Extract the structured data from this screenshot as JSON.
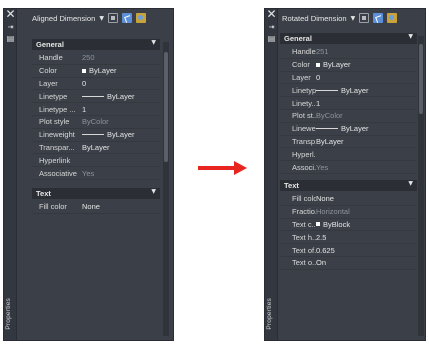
{
  "left": {
    "title": "Aligned Dimension",
    "strip_label": "Properties",
    "sections": {
      "general": {
        "title": "General",
        "rows": [
          {
            "label": "Handle",
            "value": "250",
            "readonly": true
          },
          {
            "label": "Color",
            "value": "ByLayer",
            "swatch": true
          },
          {
            "label": "Layer",
            "value": "0"
          },
          {
            "label": "Linetype",
            "value": "ByLayer",
            "line": true
          },
          {
            "label": "Linetype ...",
            "value": "1"
          },
          {
            "label": "Plot style",
            "value": "ByColor",
            "readonly": true
          },
          {
            "label": "Lineweight",
            "value": "ByLayer",
            "line": true
          },
          {
            "label": "Transpar...",
            "value": "ByLayer"
          },
          {
            "label": "Hyperlink",
            "value": ""
          },
          {
            "label": "Associative",
            "value": "Yes",
            "readonly": true
          }
        ]
      },
      "text": {
        "title": "Text",
        "rows": [
          {
            "label": "Fill color",
            "value": "None"
          }
        ]
      }
    }
  },
  "right": {
    "title": "Rotated Dimension",
    "strip_label": "Properties",
    "sections": {
      "general": {
        "title": "General",
        "rows": [
          {
            "label": "Handle",
            "value": "251",
            "readonly": true
          },
          {
            "label": "Color",
            "value": "ByLayer",
            "swatch": true
          },
          {
            "label": "Layer",
            "value": "0"
          },
          {
            "label": "Linetype",
            "value": "ByLayer",
            "line": true
          },
          {
            "label": "Linety...",
            "value": "1"
          },
          {
            "label": "Plot st...",
            "value": "ByColor",
            "readonly": true
          },
          {
            "label": "Linewe...",
            "value": "ByLayer",
            "line": true
          },
          {
            "label": "Transp...",
            "value": "ByLayer"
          },
          {
            "label": "Hyperl...",
            "value": ""
          },
          {
            "label": "Associ...",
            "value": "Yes",
            "readonly": true
          }
        ]
      },
      "text": {
        "title": "Text",
        "rows": [
          {
            "label": "Fill color",
            "value": "None"
          },
          {
            "label": "Fractio...",
            "value": "Horizontal",
            "readonly": true
          },
          {
            "label": "Text c...",
            "value": "ByBlock",
            "swatch": true
          },
          {
            "label": "Text h...",
            "value": "2.5"
          },
          {
            "label": "Text of...",
            "value": "0.625"
          },
          {
            "label": "Text o...",
            "value": "On"
          }
        ]
      }
    }
  },
  "icons": {
    "close": "close-icon",
    "pin": "pin-icon",
    "menu": "properties-menu-icon",
    "quick_select": "quick-select-icon",
    "select_objects": "select-objects-icon",
    "pickadd": "pickadd-icon"
  },
  "colors": {
    "palette_bg": "#3b4048",
    "section_bg": "#2b2f35",
    "arrow": "#e8261f"
  }
}
